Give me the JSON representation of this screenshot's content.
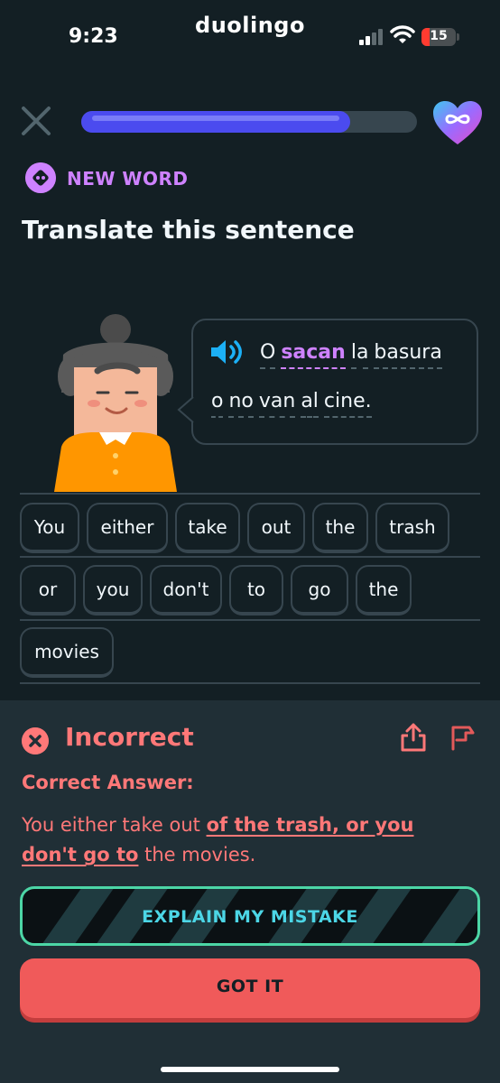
{
  "status_bar": {
    "time": "9:23",
    "app_label": "duolingo",
    "battery": "15"
  },
  "header": {
    "progress": 0.8
  },
  "lesson": {
    "badge": "NEW WORD",
    "prompt": "Translate this sentence",
    "sentence_line1": [
      "O",
      "sacan",
      "la",
      "basura"
    ],
    "sentence_line2": [
      "o",
      "no",
      "van",
      "al",
      "cine."
    ],
    "highlighted_word": "sacan"
  },
  "word_bank": [
    "You",
    "either",
    "take",
    "out",
    "the",
    "trash",
    "or",
    "you",
    "don't",
    "to",
    "go",
    "the",
    "movies"
  ],
  "feedback": {
    "title": "Incorrect",
    "subtitle": "Correct Answer:",
    "answer_plain_1": "You either take out ",
    "answer_bold_1": "of the trash, or you",
    "answer_bold_2": "don't go to",
    "answer_plain_2": " the movies.",
    "explain_label": "EXPLAIN MY MISTAKE",
    "gotit_label": "GOT IT"
  },
  "colors": {
    "accent_purple": "#ce82ff",
    "error_red": "#ff7878",
    "progress_blue": "#4b4bef",
    "teal": "#4cd6a6"
  },
  "icons": [
    "close-icon",
    "heart-infinity-icon",
    "new-word-icon",
    "speaker-icon",
    "error-x-icon",
    "share-icon",
    "flag-icon"
  ]
}
